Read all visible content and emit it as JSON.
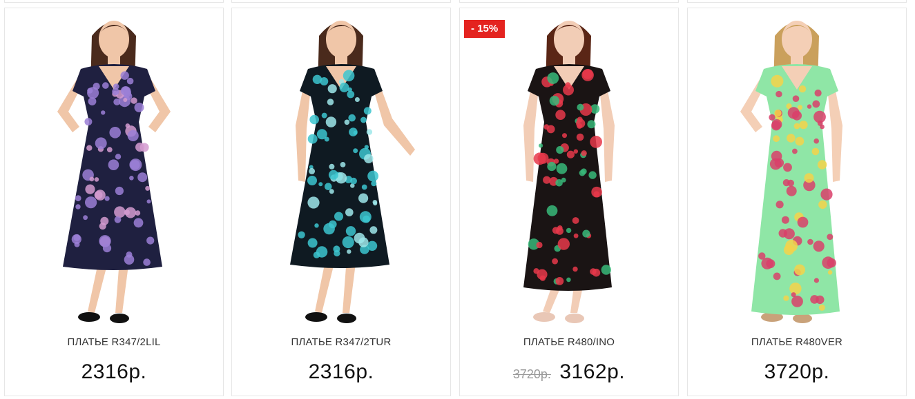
{
  "products": [
    {
      "name": "ПЛАТЬЕ R347/2LIL",
      "price": "2316р.",
      "old_price": "",
      "badge": "",
      "image": "dress-lilac-floral",
      "colors": {
        "dress": "#1f2040",
        "flower": "#9b7fd6",
        "accent": "#d49bd0",
        "skin": "#f0c6a8",
        "hair": "#4a2a1c"
      }
    },
    {
      "name": "ПЛАТЬЕ R347/2TUR",
      "price": "2316р.",
      "old_price": "",
      "badge": "",
      "image": "dress-turquoise-floral",
      "colors": {
        "dress": "#0f1a22",
        "flower": "#3cc6cf",
        "accent": "#9ee7ea",
        "skin": "#f0c6a8",
        "hair": "#4a2a1c"
      }
    },
    {
      "name": "ПЛАТЬЕ R480/INO",
      "price": "3162р.",
      "old_price": "3720р.",
      "badge": "- 15%",
      "image": "dress-multicolor-floral",
      "colors": {
        "dress": "#1a1414",
        "flower": "#e8384a",
        "accent": "#38b879",
        "skin": "#f2cdb6",
        "hair": "#5a2616"
      }
    },
    {
      "name": "ПЛАТЬЕ R480VER",
      "price": "3720р.",
      "old_price": "",
      "badge": "",
      "image": "dress-green-blossom",
      "colors": {
        "dress": "#8fe6a6",
        "flower": "#d9406a",
        "accent": "#f4d24a",
        "skin": "#f4cfb6",
        "hair": "#caa05c"
      }
    }
  ]
}
